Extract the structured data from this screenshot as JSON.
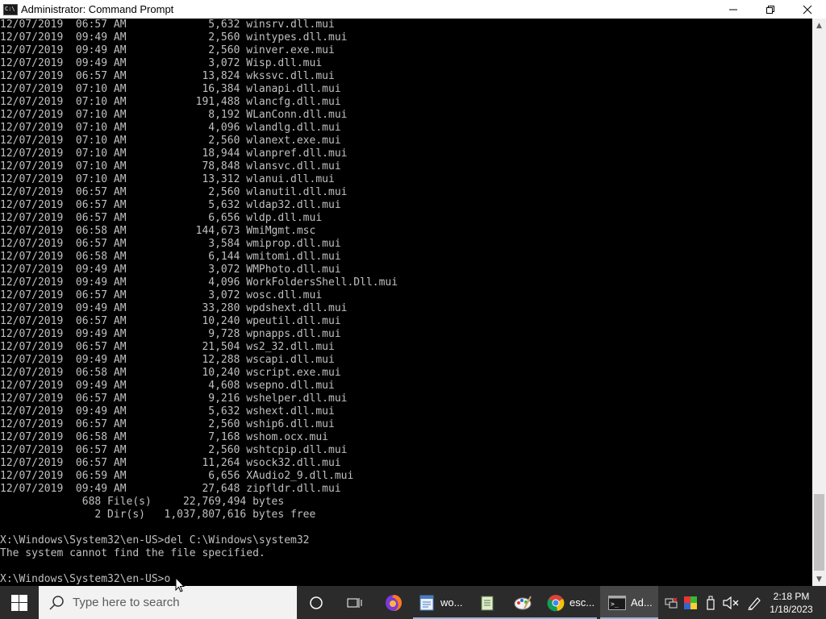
{
  "window": {
    "title": "Administrator: Command Prompt",
    "icon_text": "C:\\"
  },
  "titlebar_controls": [
    "minimize-icon",
    "restore-icon",
    "close-icon"
  ],
  "console": {
    "lines": [
      "12/07/2019  06:57 AM             5,632 winsrv.dll.mui",
      "12/07/2019  09:49 AM             2,560 wintypes.dll.mui",
      "12/07/2019  09:49 AM             2,560 winver.exe.mui",
      "12/07/2019  09:49 AM             3,072 Wisp.dll.mui",
      "12/07/2019  06:57 AM            13,824 wkssvc.dll.mui",
      "12/07/2019  07:10 AM            16,384 wlanapi.dll.mui",
      "12/07/2019  07:10 AM           191,488 wlancfg.dll.mui",
      "12/07/2019  07:10 AM             8,192 WLanConn.dll.mui",
      "12/07/2019  07:10 AM             4,096 wlandlg.dll.mui",
      "12/07/2019  07:10 AM             2,560 wlanext.exe.mui",
      "12/07/2019  07:10 AM            18,944 wlanpref.dll.mui",
      "12/07/2019  07:10 AM            78,848 wlansvc.dll.mui",
      "12/07/2019  07:10 AM            13,312 wlanui.dll.mui",
      "12/07/2019  06:57 AM             2,560 wlanutil.dll.mui",
      "12/07/2019  06:57 AM             5,632 wldap32.dll.mui",
      "12/07/2019  06:57 AM             6,656 wldp.dll.mui",
      "12/07/2019  06:58 AM           144,673 WmiMgmt.msc",
      "12/07/2019  06:57 AM             3,584 wmiprop.dll.mui",
      "12/07/2019  06:58 AM             6,144 wmitomi.dll.mui",
      "12/07/2019  09:49 AM             3,072 WMPhoto.dll.mui",
      "12/07/2019  09:49 AM             4,096 WorkFoldersShell.Dll.mui",
      "12/07/2019  06:57 AM             3,072 wosc.dll.mui",
      "12/07/2019  09:49 AM            33,280 wpdshext.dll.mui",
      "12/07/2019  06:57 AM            10,240 wpeutil.dll.mui",
      "12/07/2019  09:49 AM             9,728 wpnapps.dll.mui",
      "12/07/2019  06:57 AM            21,504 ws2_32.dll.mui",
      "12/07/2019  09:49 AM            12,288 wscapi.dll.mui",
      "12/07/2019  06:58 AM            10,240 wscript.exe.mui",
      "12/07/2019  09:49 AM             4,608 wsepno.dll.mui",
      "12/07/2019  06:57 AM             9,216 wshelper.dll.mui",
      "12/07/2019  09:49 AM             5,632 wshext.dll.mui",
      "12/07/2019  06:57 AM             2,560 wship6.dll.mui",
      "12/07/2019  06:58 AM             7,168 wshom.ocx.mui",
      "12/07/2019  06:57 AM             2,560 wshtcpip.dll.mui",
      "12/07/2019  06:57 AM            11,264 wsock32.dll.mui",
      "12/07/2019  06:59 AM             6,656 XAudio2_9.dll.mui",
      "12/07/2019  09:49 AM            27,648 zipfldr.dll.mui",
      "             688 File(s)     22,769,494 bytes",
      "               2 Dir(s)   1,037,807,616 bytes free",
      "",
      "X:\\Windows\\System32\\en-US>del C:\\Windows\\system32",
      "The system cannot find the file specified.",
      "",
      "X:\\Windows\\System32\\en-US>o"
    ]
  },
  "scrollbar": {
    "up_arrow": "▲",
    "down_arrow": "▼"
  },
  "taskbar": {
    "search_placeholder": "Type here to search",
    "pinned": [
      {
        "name": "cortana-icon"
      },
      {
        "name": "task-view-icon"
      },
      {
        "name": "firefox-icon"
      }
    ],
    "apps": [
      {
        "name": "wordpad",
        "label": "wo...",
        "active": false
      },
      {
        "name": "notepad",
        "label": "",
        "active": false
      },
      {
        "name": "paint",
        "label": "",
        "active": false
      },
      {
        "name": "chrome",
        "label": "esc...",
        "active": false
      },
      {
        "name": "command-prompt",
        "label": "Ad...",
        "active": true
      }
    ],
    "tray_icons": [
      "network-icon",
      "color-icon",
      "usb-icon",
      "volume-muted-icon",
      "pen-icon"
    ],
    "clock": {
      "time": "2:18 PM",
      "date": "1/18/2023"
    }
  },
  "colors": {
    "console_bg": "#000000",
    "console_text": "#c0c0c0",
    "taskbar_bg": "#2b2b2b",
    "active_underline": "#8fb4d9"
  }
}
